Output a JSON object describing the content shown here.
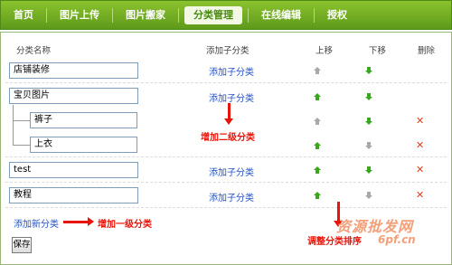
{
  "nav": {
    "items": [
      {
        "label": "首页"
      },
      {
        "label": "图片上传"
      },
      {
        "label": "图片搬家"
      },
      {
        "label": "分类管理"
      },
      {
        "label": "在线编辑"
      },
      {
        "label": "授权"
      }
    ],
    "active_index": 3
  },
  "table": {
    "headers": {
      "name": "分类名称",
      "add_sub": "添加子分类",
      "move_up": "上移",
      "move_down": "下移",
      "delete": "删除"
    },
    "rows": [
      {
        "name": "店铺装修",
        "add_sub": "添加子分类",
        "level": 1
      },
      {
        "name": "宝贝图片",
        "add_sub": "添加子分类",
        "level": 1
      },
      {
        "name": "裤子",
        "add_sub": "",
        "level": 2
      },
      {
        "name": "上衣",
        "add_sub": "",
        "level": 2
      },
      {
        "name": "test",
        "add_sub": "添加子分类",
        "level": 1
      },
      {
        "name": "教程",
        "add_sub": "添加子分类",
        "level": 1
      }
    ]
  },
  "add_new_category": "添加新分类",
  "save_label": "保存",
  "annotations": {
    "add_second_level": "增加二级分类",
    "add_first_level": "增加一级分类",
    "adjust_sort": "调整分类排序"
  },
  "watermark": {
    "text": "资源批发网",
    "url": "6pf.cn"
  },
  "colors": {
    "nav_bg": "#6fa822",
    "arrow_green": "#3aa81c",
    "arrow_disabled": "#a8a8a8",
    "delete_red": "#e0401c",
    "link_blue": "#2553c4",
    "annotation_red": "#e8140a"
  }
}
